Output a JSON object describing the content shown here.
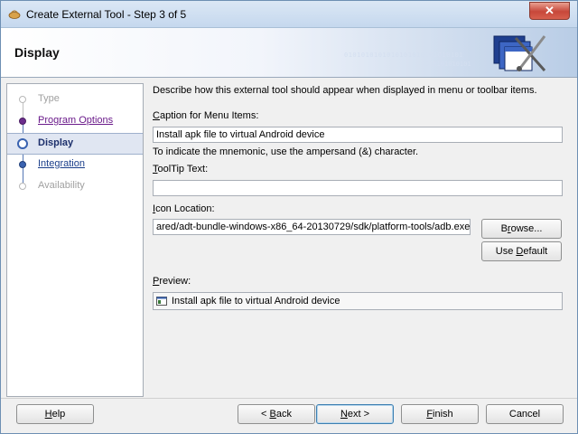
{
  "window": {
    "title": "Create External Tool - Step 3 of 5",
    "close_label": "✕"
  },
  "header": {
    "title": "Display",
    "binary_a": "0101010101010101010101010101",
    "binary_b": "010101010101"
  },
  "steps": [
    {
      "label": "Type",
      "state": "disabled"
    },
    {
      "label": "Program Options",
      "state": "done"
    },
    {
      "label": "Display",
      "state": "current"
    },
    {
      "label": "Integration",
      "state": "link"
    },
    {
      "label": "Availability",
      "state": "disabled"
    }
  ],
  "form": {
    "description": "Describe how this external tool should appear when displayed in menu or toolbar items.",
    "caption_label_m": "C",
    "caption_label_rest": "aption for Menu Items:",
    "caption_value": "Install apk file to virtual Android device",
    "mnemonic_hint": "To indicate the mnemonic, use the ampersand (&) character.",
    "tooltip_label_m": "T",
    "tooltip_label_rest": "oolTip Text:",
    "tooltip_value": "",
    "icon_label_m": "I",
    "icon_label_rest": "con Location:",
    "icon_value": "ared/adt-bundle-windows-x86_64-20130729/sdk/platform-tools/adb.exe",
    "browse_pre": "B",
    "browse_m": "r",
    "browse_post": "owse...",
    "use_default_pre": "Use ",
    "use_default_m": "D",
    "use_default_post": "efault",
    "preview_label_m": "P",
    "preview_label_rest": "review:",
    "preview_value": "Install apk file to virtual Android device"
  },
  "footer": {
    "help_m": "H",
    "help_rest": "elp",
    "back_pre": "< ",
    "back_m": "B",
    "back_post": "ack",
    "next_m": "N",
    "next_post": "ext >",
    "finish_m": "F",
    "finish_post": "inish",
    "cancel": "Cancel"
  }
}
